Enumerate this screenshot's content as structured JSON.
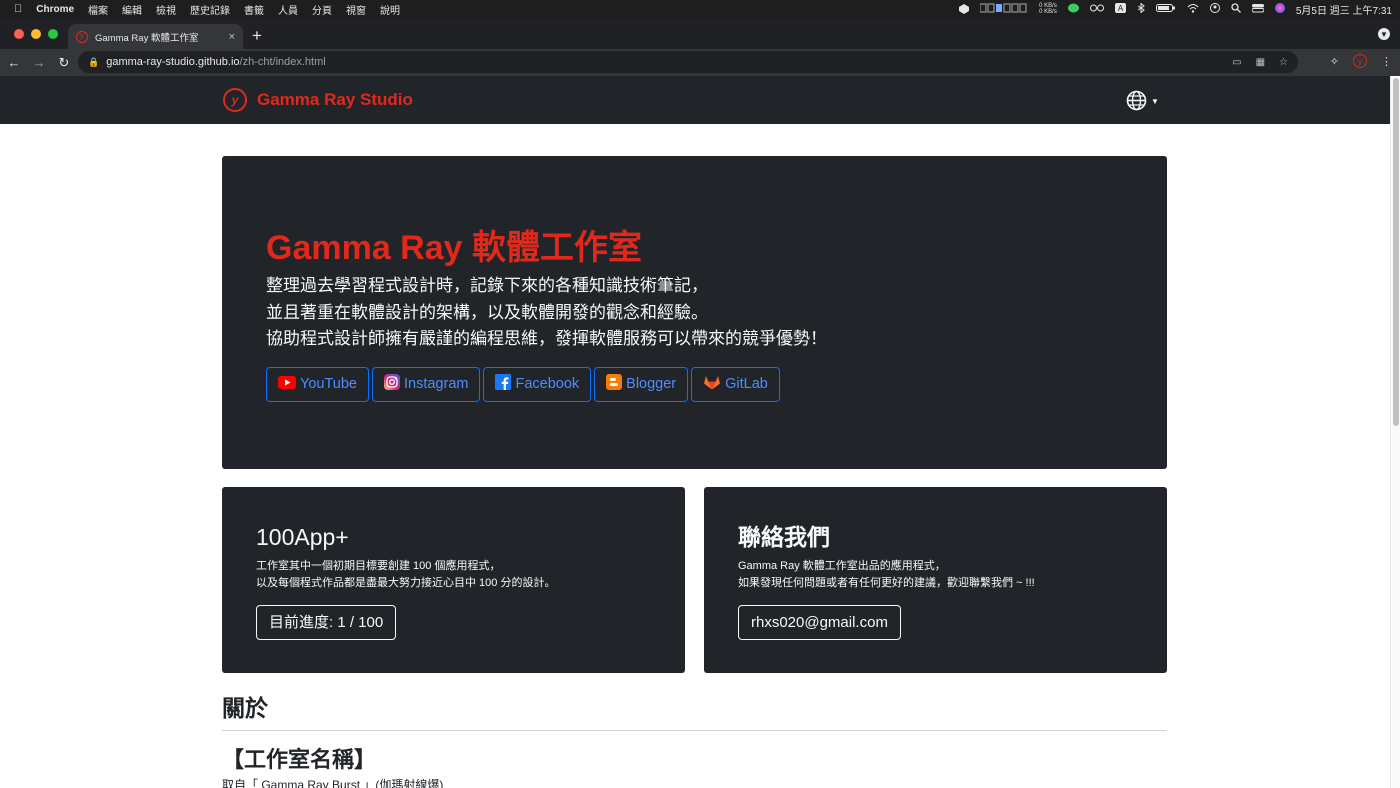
{
  "menubar": {
    "apple": "",
    "app": "Chrome",
    "items": [
      "檔案",
      "編輯",
      "檢視",
      "歷史記錄",
      "書籤",
      "人員",
      "分頁",
      "視窗",
      "說明"
    ],
    "net_up": "0 KB/s",
    "net_down": "0 KB/s",
    "clock": "5月5日 週三 上午7:31"
  },
  "browser": {
    "tab_title": "Gamma Ray 軟體工作室",
    "tab_close": "×",
    "new_tab": "+",
    "url_host": "gamma-ray-studio.github.io",
    "url_path": "/zh-cht/index.html",
    "profile": "y"
  },
  "navbar": {
    "brand": "Gamma Ray Studio",
    "logo": "y"
  },
  "hero": {
    "title": "Gamma Ray 軟體工作室",
    "line1": "整理過去學習程式設計時，記錄下來的各種知識技術筆記，",
    "line2": "並且著重在軟體設計的架構，以及軟體開發的觀念和經驗。",
    "line3": "協助程式設計師擁有嚴謹的編程思維，發揮軟體服務可以帶來的競爭優勢！",
    "buttons": [
      {
        "label": "YouTube",
        "color": "#ff0000"
      },
      {
        "label": "Instagram",
        "color": "#d62976"
      },
      {
        "label": "Facebook",
        "color": "#1877f2"
      },
      {
        "label": "Blogger",
        "color": "#f57d00"
      },
      {
        "label": "GitLab",
        "color": "#fc6d26"
      }
    ]
  },
  "card_app": {
    "title": "100App+",
    "line1": "工作室其中一個初期目標要創建 100 個應用程式，",
    "line2": "以及每個程式作品都是盡最大努力接近心目中 100 分的設計。",
    "button": "目前進度: 1 / 100"
  },
  "card_contact": {
    "title": "聯絡我們",
    "line1": "Gamma Ray 軟體工作室出品的應用程式，",
    "line2": "如果發現任何問題或者有任何更好的建議，歡迎聯繫我們 ~ !!!",
    "button": "rhxs020@gmail.com"
  },
  "about": {
    "heading": "關於",
    "subheading": "【工作室名稱】",
    "cutoff": "取自「 Gamma Ray Burst 」(伽瑪射線爆)"
  },
  "colors": {
    "brand_red": "#e0291b",
    "dark": "#212529",
    "link_blue": "#0d6efd"
  }
}
